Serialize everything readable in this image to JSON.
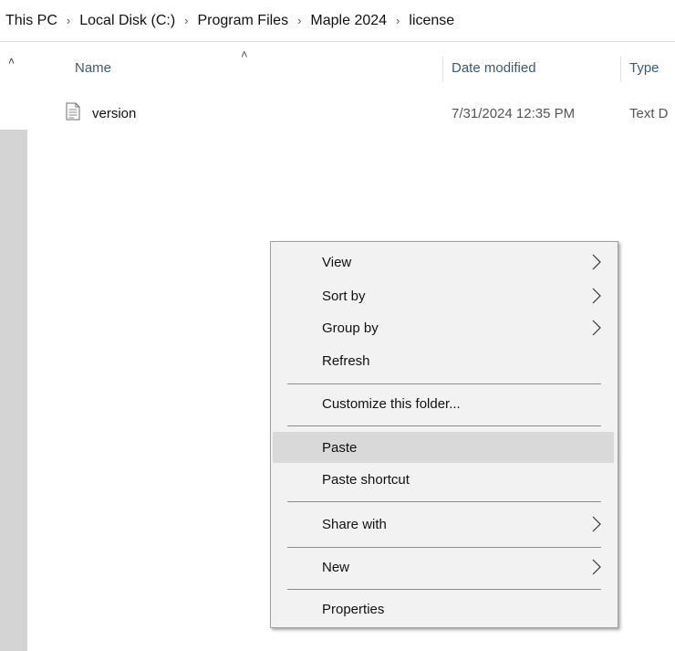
{
  "breadcrumb": {
    "items": [
      "This PC",
      "Local Disk (C:)",
      "Program Files",
      "Maple 2024",
      "license"
    ]
  },
  "columns": {
    "name": "Name",
    "date_modified": "Date modified",
    "type": "Type"
  },
  "files": [
    {
      "name": "version",
      "date_modified": "7/31/2024 12:35 PM",
      "type": "Text D",
      "icon": "text-document-icon"
    }
  ],
  "context_menu": {
    "items": [
      {
        "label": "View",
        "submenu": true
      },
      {
        "label": "Sort by",
        "submenu": true
      },
      {
        "label": "Group by",
        "submenu": true
      },
      {
        "label": "Refresh",
        "submenu": false
      },
      {
        "label": "Customize this folder...",
        "submenu": false
      },
      {
        "label": "Paste",
        "submenu": false,
        "highlighted": true
      },
      {
        "label": "Paste shortcut",
        "submenu": false
      },
      {
        "label": "Share with",
        "submenu": true
      },
      {
        "label": "New",
        "submenu": true
      },
      {
        "label": "Properties",
        "submenu": false
      }
    ]
  },
  "colors": {
    "menu_background": "#f2f2f2",
    "menu_highlight": "#d9d9d9",
    "header_text": "#3c5a7a",
    "scroll_track": "#d4d4d4"
  }
}
